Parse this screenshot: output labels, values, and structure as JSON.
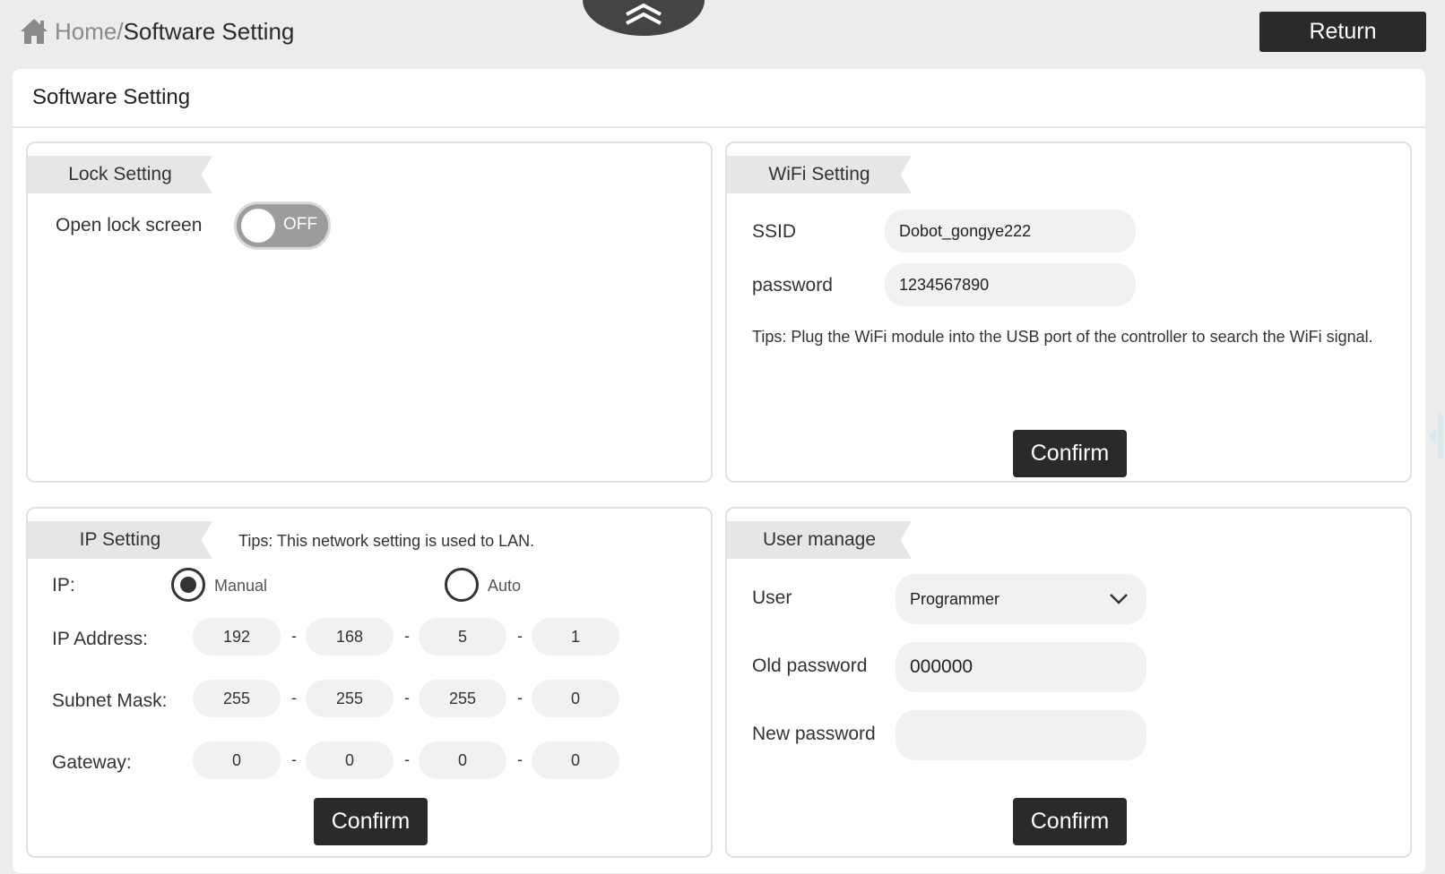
{
  "breadcrumb": {
    "home": "Home",
    "separator": "/",
    "current": "Software Setting"
  },
  "header": {
    "return_label": "Return"
  },
  "main": {
    "title": "Software Setting"
  },
  "lock": {
    "tab": "Lock Setting",
    "label": "Open lock screen",
    "toggle_state": "OFF"
  },
  "wifi": {
    "tab": "WiFi Setting",
    "ssid_label": "SSID",
    "ssid_value": "Dobot_gongye222",
    "password_label": "password",
    "password_value": "1234567890",
    "tips": "Tips: Plug the WiFi module into the USB port of the controller to search the WiFi signal.",
    "confirm": "Confirm"
  },
  "ip": {
    "tab": "IP Setting",
    "tips": "Tips: This network setting is used to LAN.",
    "ip_label": "IP:",
    "manual_label": "Manual",
    "auto_label": "Auto",
    "selected": "Manual",
    "address_label": "IP Address:",
    "address": [
      "192",
      "168",
      "5",
      "1"
    ],
    "mask_label": "Subnet Mask:",
    "mask": [
      "255",
      "255",
      "255",
      "0"
    ],
    "gateway_label": "Gateway:",
    "gateway": [
      "0",
      "0",
      "0",
      "0"
    ],
    "separator": "-",
    "confirm": "Confirm"
  },
  "user": {
    "tab": "User manage",
    "user_label": "User",
    "user_value": "Programmer",
    "old_label": "Old password",
    "old_value": "000000",
    "new_label": "New password",
    "new_value": "",
    "confirm": "Confirm"
  }
}
